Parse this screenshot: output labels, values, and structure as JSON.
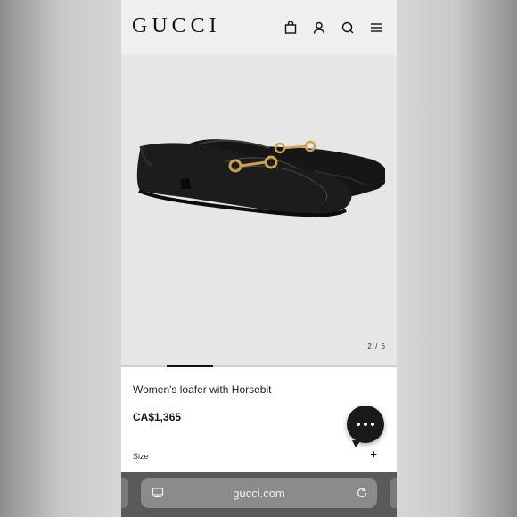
{
  "header": {
    "logo": "GUCCI",
    "icons": [
      "bag-icon",
      "account-icon",
      "search-icon",
      "menu-icon"
    ]
  },
  "gallery": {
    "counter": "2 / 6",
    "current_index": 2,
    "total_images": 6
  },
  "product": {
    "title": "Women's loafer with Horsebit",
    "price": "CA$1,365",
    "size_label": "Size",
    "size_expand": "+"
  },
  "browser": {
    "url": "gucci.com"
  },
  "colors": {
    "accent": "#111111",
    "gold": "#c9a24a",
    "bar": "#5a5a5a"
  }
}
